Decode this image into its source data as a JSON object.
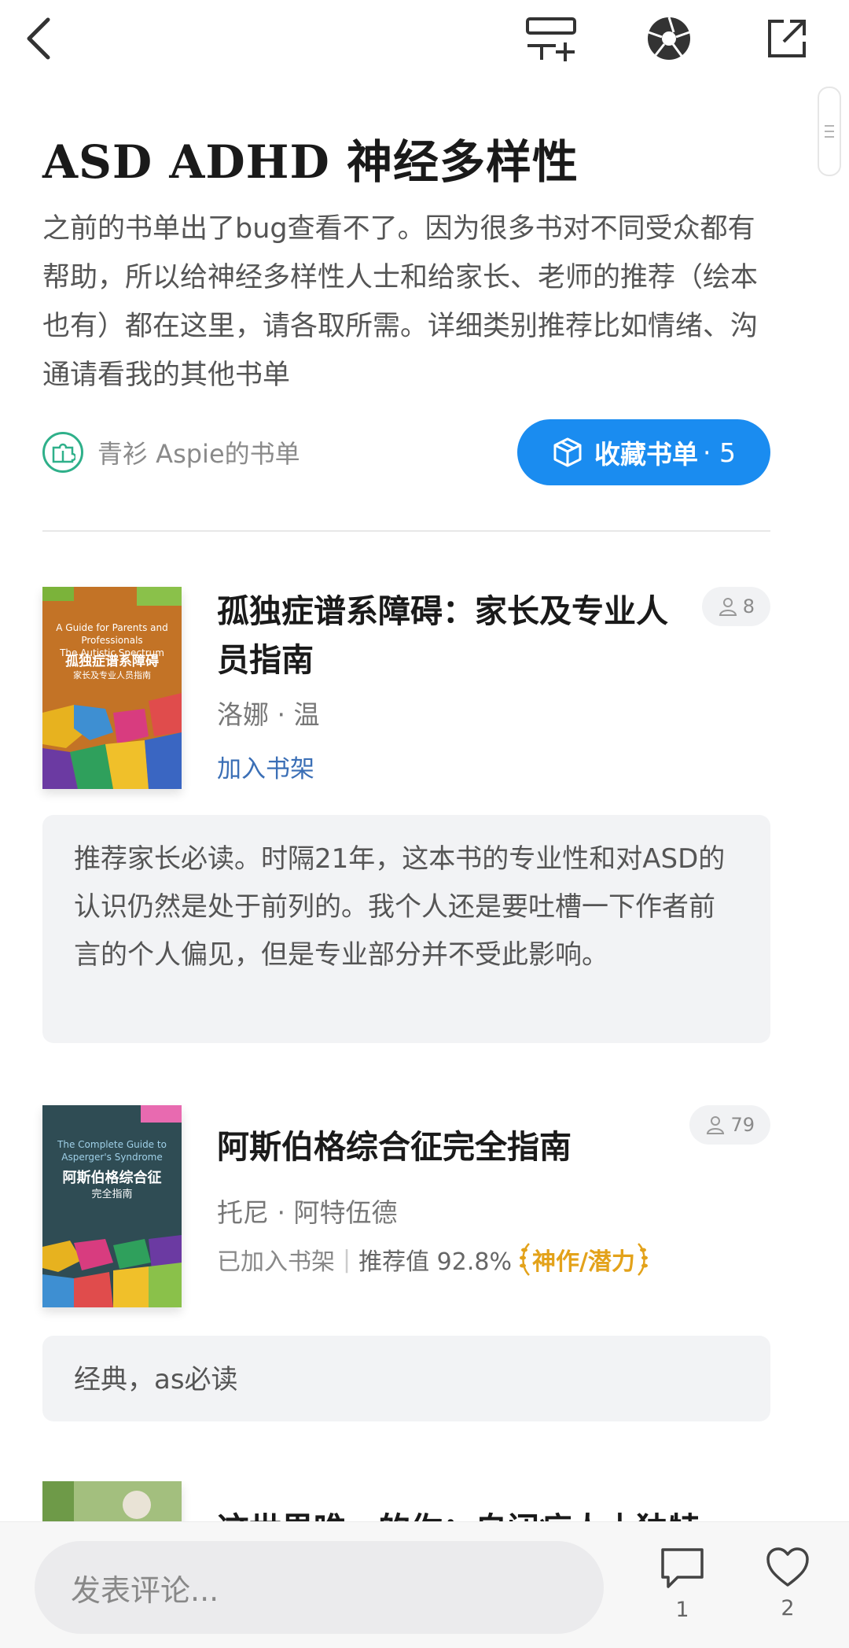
{
  "header": {
    "back_icon": "chevron-left-icon",
    "add_to_list_icon": "list-add-icon",
    "camera_icon": "aperture-icon",
    "share_icon": "share-external-icon"
  },
  "booklist": {
    "title": "ASD ADHD 神经多样性",
    "description": "之前的书单出了bug查看不了。因为很多书对不同受众都有帮助，所以给神经多样性人士和给家长、老师的推荐（绘本也有）都在这里，请各取所需。详细类别推荐比如情绪、沟通请看我的其他书单",
    "author_name": "青衫 Aspie的书单",
    "collect_label": "收藏书单",
    "collect_count": "· 5"
  },
  "books": [
    {
      "title": "孤独症谱系障碍：家长及专业人员指南",
      "author": "洛娜 · 温",
      "readers": "8",
      "shelf_action": "加入书架",
      "cover_en": "A Guide for Parents and Professionals\nThe Autistic Spectrum",
      "cover_cn": "孤独症谱系障碍",
      "cover_sub": "家长及专业人员指南",
      "comment": "推荐家长必读。时隔21年，这本书的专业性和对ASD的认识仍然是处于前列的。我个人还是要吐槽一下作者前言的个人偏见，但是专业部分并不受此影响。"
    },
    {
      "title": "阿斯伯格综合征完全指南",
      "author": "托尼 · 阿特伍德",
      "readers": "79",
      "shelf_status": "已加入书架",
      "score": "推荐值 92.8%",
      "badge": "神作/潜力",
      "cover_en": "The Complete Guide to\nAsperger's Syndrome",
      "cover_cn": "阿斯伯格综合征",
      "cover_sub": "完全指南",
      "comment": "经典，as必读"
    },
    {
      "title": "这世界唯一的你：自闭症人士独特"
    }
  ],
  "bottom": {
    "comment_placeholder": "发表评论...",
    "comment_count": "1",
    "like_count": "2"
  },
  "colors": {
    "accent_blue": "#1a8cf0",
    "link_blue": "#3b6fb6",
    "badge_gold": "#e3a21a",
    "avatar_green": "#2fb08a"
  }
}
